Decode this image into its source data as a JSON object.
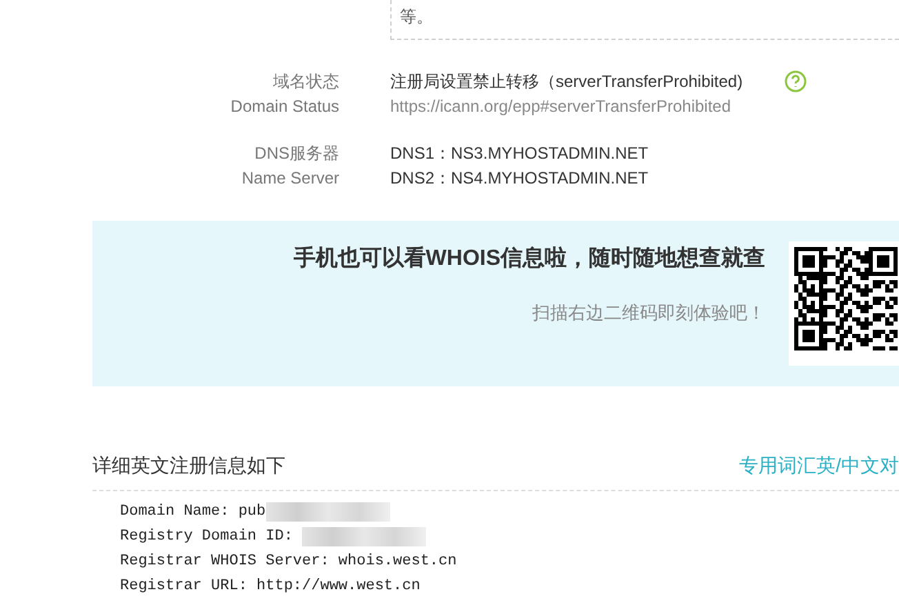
{
  "top_box": {
    "text": "等。"
  },
  "fields": [
    {
      "label_cn": "域名状态",
      "label_en": "Domain Status",
      "lines": [
        {
          "text": "注册局设置禁止转移（serverTransferProhibited)",
          "muted": false
        },
        {
          "text": "https://icann.org/epp#serverTransferProhibited",
          "muted": true
        }
      ],
      "help": true
    },
    {
      "label_cn": "DNS服务器",
      "label_en": "Name Server",
      "lines": [
        {
          "text": "DNS1：NS3.MYHOSTADMIN.NET",
          "muted": false
        },
        {
          "text": "DNS2：NS4.MYHOSTADMIN.NET",
          "muted": false
        }
      ],
      "help": false
    }
  ],
  "banner": {
    "title": "手机也可以看WHOIS信息啦，随时随地想查就查",
    "subtitle": "扫描右边二维码即刻体验吧！"
  },
  "details": {
    "heading": "详细英文注册信息如下",
    "link": "专用词汇英/中文对",
    "lines": [
      {
        "text": "Domain Name: pub",
        "redacted": true
      },
      {
        "text": "Registry Domain ID: ",
        "redacted": true
      },
      {
        "text": "Registrar WHOIS Server: whois.west.cn",
        "redacted": false
      },
      {
        "text": "Registrar URL: http://www.west.cn",
        "redacted": false
      }
    ]
  }
}
